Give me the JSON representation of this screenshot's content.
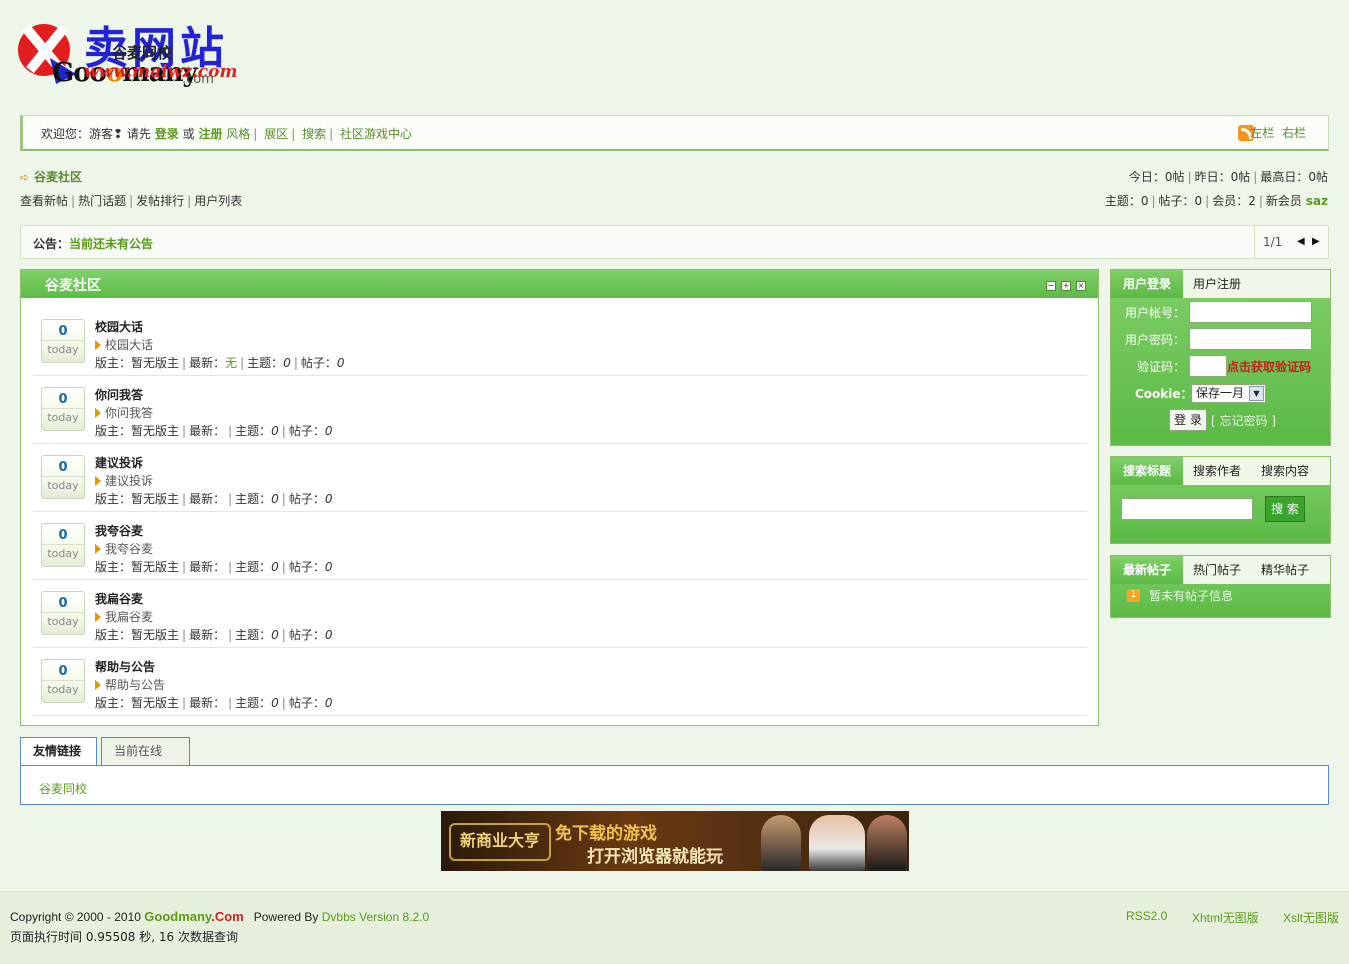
{
  "logo": {
    "big_text": "卖网站",
    "subtitle": "谷麦同校",
    "brand": "Goo",
    "brand2": "many",
    "url_text": "www.maiwz.com",
    "dot_com": ".com"
  },
  "topbar": {
    "welcome": "欢迎您：游客",
    "please": "请先",
    "login": "登录",
    "or": "或",
    "register": "注册",
    "links": [
      "风格",
      "展区",
      "搜索",
      "社区游戏中心"
    ],
    "right_links": [
      "左栏",
      "右栏"
    ]
  },
  "crumb": {
    "title": "谷麦社区"
  },
  "subnav": [
    "查看新帖",
    "热门话题",
    "发帖排行",
    "用户列表"
  ],
  "stats": {
    "today_label": "今日：",
    "today": "0",
    "today_unit": "帖",
    "yesterday_label": "昨日：",
    "yesterday": "0",
    "yesterday_unit": "帖",
    "max_label": "最高日：",
    "max": "0",
    "max_unit": "帖",
    "topics_label": "主题：",
    "topics": "0",
    "posts_label": "帖子：",
    "posts": "0",
    "members_label": "会员：",
    "members": "2",
    "newest_label": "新会员",
    "newest": "saz"
  },
  "notice": {
    "label": "公告：",
    "text": "当前还未有公告",
    "page": "1/1"
  },
  "forum": {
    "title": "谷麦社区",
    "boards": [
      {
        "count": "0",
        "today": "today",
        "name": "校园大话",
        "desc": "校园大话",
        "moderator": "暂无版主",
        "latest": "无",
        "topics": "0",
        "posts": "0"
      },
      {
        "count": "0",
        "today": "today",
        "name": "你问我答",
        "desc": "你问我答",
        "moderator": "暂无版主",
        "latest": "",
        "topics": "0",
        "posts": "0"
      },
      {
        "count": "0",
        "today": "today",
        "name": "建议投诉",
        "desc": "建议投诉",
        "moderator": "暂无版主",
        "latest": "",
        "topics": "0",
        "posts": "0"
      },
      {
        "count": "0",
        "today": "today",
        "name": "我夸谷麦",
        "desc": "我夸谷麦",
        "moderator": "暂无版主",
        "latest": "",
        "topics": "0",
        "posts": "0"
      },
      {
        "count": "0",
        "today": "today",
        "name": "我扁谷麦",
        "desc": "我扁谷麦",
        "moderator": "暂无版主",
        "latest": "",
        "topics": "0",
        "posts": "0"
      },
      {
        "count": "0",
        "today": "today",
        "name": "帮助与公告",
        "desc": "帮助与公告",
        "moderator": "暂无版主",
        "latest": "",
        "topics": "0",
        "posts": "0"
      }
    ],
    "labels": {
      "moderator": "版主：",
      "latest": "最新：",
      "topics": "主题：",
      "posts": "帖子："
    }
  },
  "login_box": {
    "tab_login": "用户登录",
    "tab_register": "用户注册",
    "user_label": "用户帐号：",
    "pass_label": "用户密码：",
    "code_label": "验证码：",
    "code_link": "点击获取验证码",
    "cookie_label": "Cookie：",
    "cookie_value": "保存一月",
    "login_button": "登 录",
    "forgot": "[ 忘记密码 ]"
  },
  "search_box": {
    "tab_title": "搜索标题",
    "tab_author": "搜索作者",
    "tab_content": "搜索内容",
    "button": "搜 索"
  },
  "posts_box": {
    "tab_latest": "最新帖子",
    "tab_hot": "热门帖子",
    "tab_best": "精华帖子",
    "badge": "1",
    "empty": "暂未有帖子信息"
  },
  "links": {
    "tab_friends": "友情链接",
    "tab_online": "当前在线(1)",
    "items": [
      "谷麦同校"
    ]
  },
  "banner": {
    "game": "新商业大亨",
    "line1": "免下载的游戏",
    "line2": "打开浏览器就能玩"
  },
  "footer": {
    "copyright": "Copyright © 2000 - 2010",
    "brand": "Goodmany",
    "brand_dot": ".Com",
    "powered": "Powered By",
    "dvbbs": "Dvbbs Version 8.2.0",
    "exec": "页面执行时间 0.95508 秒, 16 次数据查询",
    "right": [
      "RSS2.0",
      "Xhtml无图版",
      "Xslt无图版"
    ]
  },
  "colors": {
    "accent": "#5cb945",
    "link": "#5a9a1a",
    "border": "#8fbd6a",
    "background": "#eef5e9"
  }
}
